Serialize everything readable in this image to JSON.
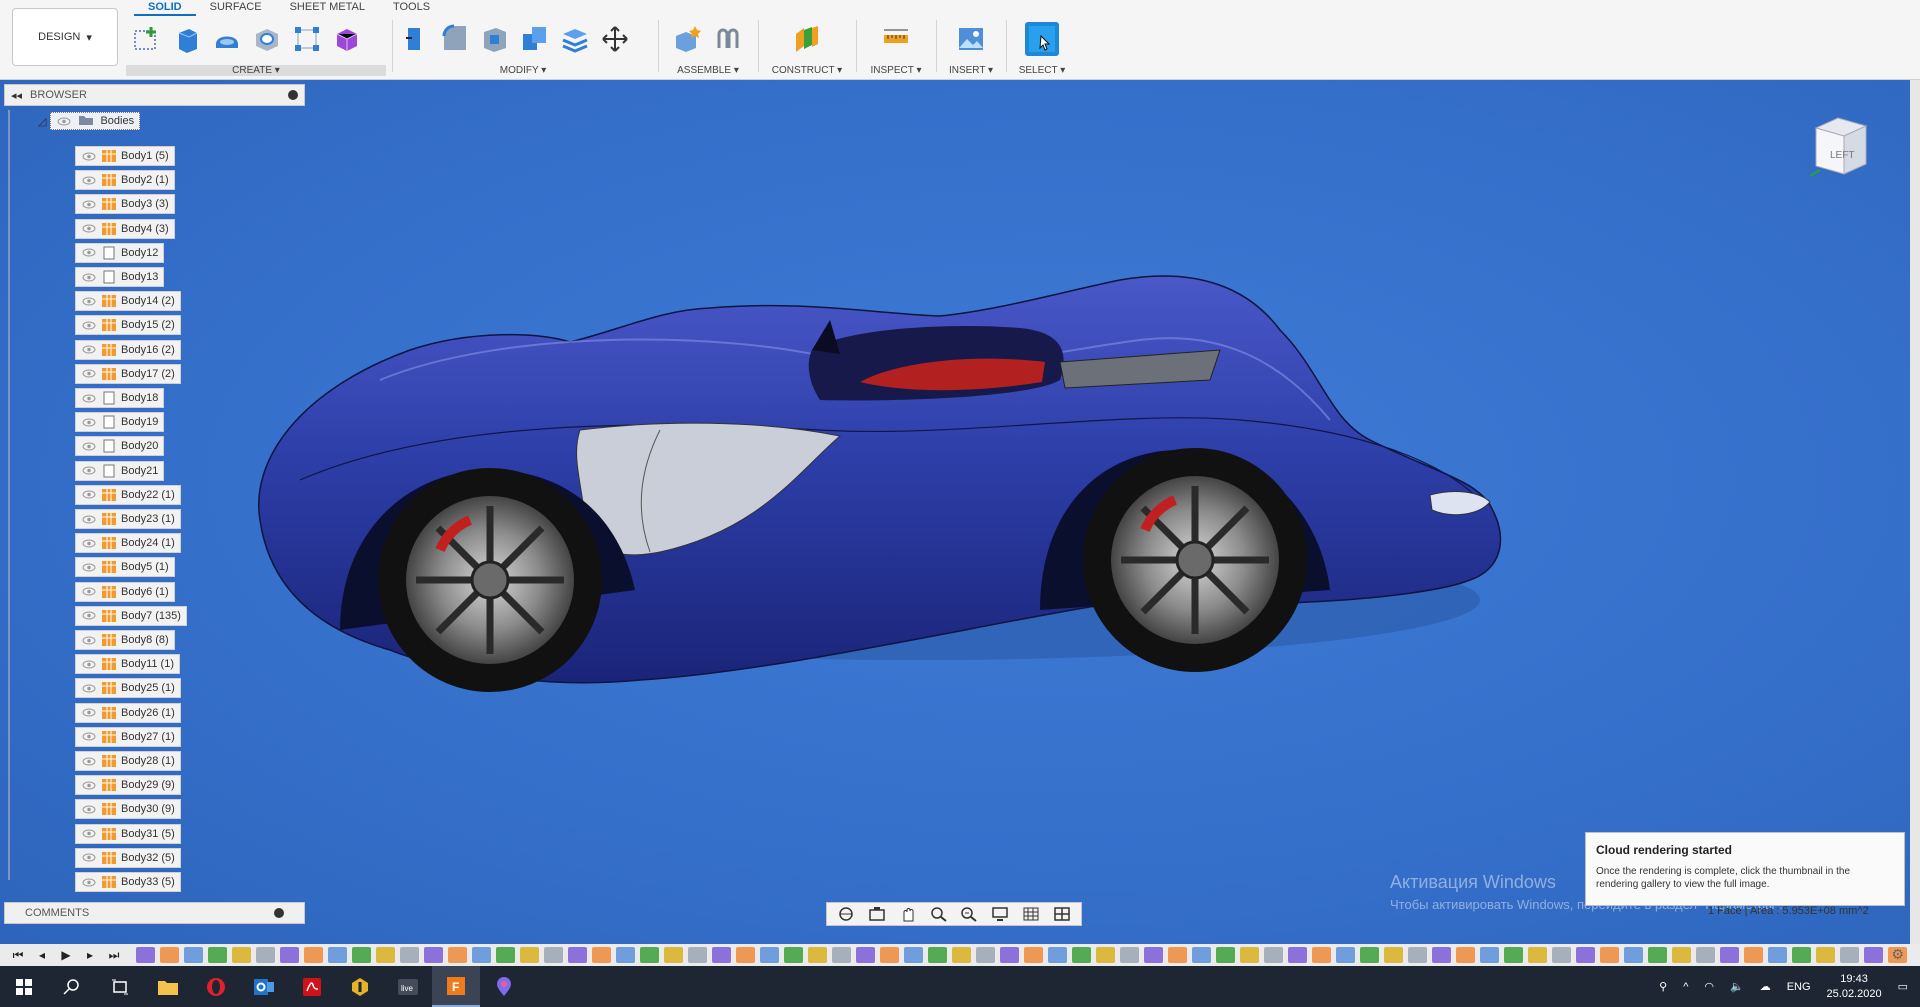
{
  "ribbon": {
    "design_label": "DESIGN",
    "tabs": [
      {
        "label": "SOLID",
        "active": true
      },
      {
        "label": "SURFACE",
        "active": false
      },
      {
        "label": "SHEET METAL",
        "active": false
      },
      {
        "label": "TOOLS",
        "active": false
      }
    ],
    "groups": {
      "create": "CREATE",
      "modify": "MODIFY",
      "assemble": "ASSEMBLE",
      "construct": "CONSTRUCT",
      "inspect": "INSPECT",
      "insert": "INSERT",
      "select": "SELECT"
    }
  },
  "browser": {
    "title": "BROWSER",
    "root": "Bodies",
    "items": [
      "Body1 (5)",
      "Body2 (1)",
      "Body3 (3)",
      "Body4 (3)",
      "Body12",
      "Body13",
      "Body14 (2)",
      "Body15 (2)",
      "Body16 (2)",
      "Body17 (2)",
      "Body18",
      "Body19",
      "Body20",
      "Body21",
      "Body22 (1)",
      "Body23 (1)",
      "Body24 (1)",
      "Body5 (1)",
      "Body6 (1)",
      "Body7 (135)",
      "Body8 (8)",
      "Body11 (1)",
      "Body25 (1)",
      "Body26 (1)",
      "Body27 (1)",
      "Body28 (1)",
      "Body29 (9)",
      "Body30 (9)",
      "Body31 (5)",
      "Body32 (5)",
      "Body33 (5)"
    ]
  },
  "comments": {
    "title": "COMMENTS"
  },
  "viewcube": {
    "face": "LEFT"
  },
  "toast": {
    "title": "Cloud rendering started",
    "message": "Once the rendering is complete, click the thumbnail in the rendering gallery to view the full image."
  },
  "watermark": {
    "line1": "Активация Windows",
    "line2": "Чтобы активировать Windows, перейдите в раздел \"Параметры\"."
  },
  "status": {
    "selection": "1 Face | Area : 5.953E+08 mm^2"
  },
  "taskbar": {
    "lang": "ENG",
    "time": "19:43",
    "date": "25.02.2020"
  },
  "colors": {
    "accent": "#0d6fc2",
    "viewport": "#3570cb",
    "car_body": "#2c3ea6"
  }
}
